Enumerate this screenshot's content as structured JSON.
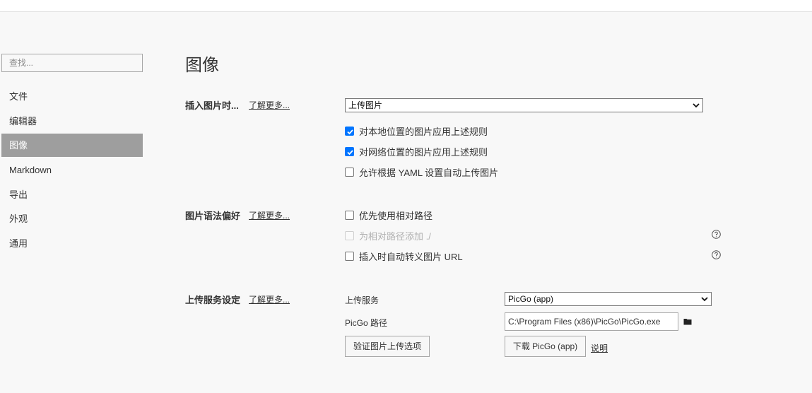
{
  "sidebar": {
    "search_placeholder": "查找...",
    "items": [
      {
        "label": "文件"
      },
      {
        "label": "编辑器"
      },
      {
        "label": "图像",
        "active": true
      },
      {
        "label": "Markdown"
      },
      {
        "label": "导出"
      },
      {
        "label": "外观"
      },
      {
        "label": "通用"
      }
    ]
  },
  "main": {
    "title": "图像",
    "learn_more": "了解更多...",
    "insert": {
      "label": "插入图片时...",
      "select_value": "上传图片",
      "options": [
        {
          "label": "对本地位置的图片应用上述规则",
          "checked": true
        },
        {
          "label": "对网络位置的图片应用上述规则",
          "checked": true
        },
        {
          "label": "允许根据 YAML 设置自动上传图片",
          "checked": false
        }
      ]
    },
    "syntax": {
      "label": "图片语法偏好",
      "options": [
        {
          "label": "优先使用相对路径",
          "checked": false
        },
        {
          "label": "为相对路径添加 ./",
          "checked": false,
          "disabled": true
        },
        {
          "label": "插入时自动转义图片 URL",
          "checked": false
        }
      ]
    },
    "upload": {
      "label": "上传服务设定",
      "service_label": "上传服务",
      "service_value": "PicGo (app)",
      "path_label": "PicGo 路径",
      "path_value": "C:\\Program Files (x86)\\PicGo\\PicGo.exe",
      "verify_button": "验证图片上传选项",
      "download_button": "下载 PicGo (app)",
      "help_link": "说明"
    }
  },
  "colors": {
    "accent": "#0075ff",
    "active_nav_bg": "#9e9e9e",
    "background": "#f8f8f8"
  }
}
